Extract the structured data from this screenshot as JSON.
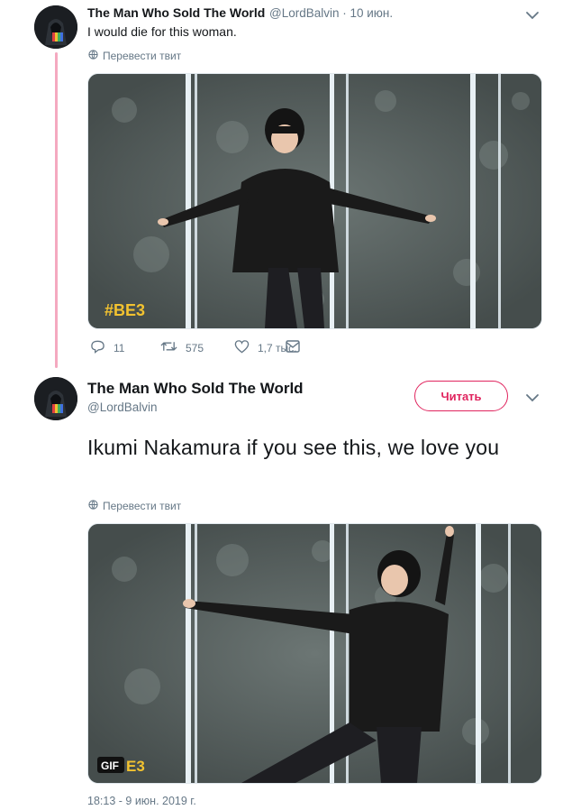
{
  "tweet1": {
    "name": "The Man Who Sold The World",
    "handle": "@LordBalvin",
    "date": " · 10 июн.",
    "text": "I would die for this woman.",
    "translate": "Перевести твит",
    "media_watermark": "#BE3",
    "replies": "11",
    "retweets": "575",
    "likes": "1,7 тыс."
  },
  "tweet2": {
    "name": "The Man Who Sold The World",
    "handle": "@LordBalvin",
    "follow_label": "Читать",
    "text": "Ikumi Nakamura if you see this, we love you",
    "translate": "Перевести твит",
    "gif_badge": "GIF",
    "media_watermark": "E3",
    "timestamp": "18:13 - 9 июн. 2019 г."
  },
  "colors": {
    "accent_pink": "#e0245e",
    "thread_line": "#f4a9c0",
    "secondary_text": "#657786",
    "watermark_yellow": "#f2c230"
  },
  "icons": [
    "chevron-down-icon",
    "globe-icon",
    "reply-icon",
    "retweet-icon",
    "like-icon",
    "message-icon"
  ]
}
